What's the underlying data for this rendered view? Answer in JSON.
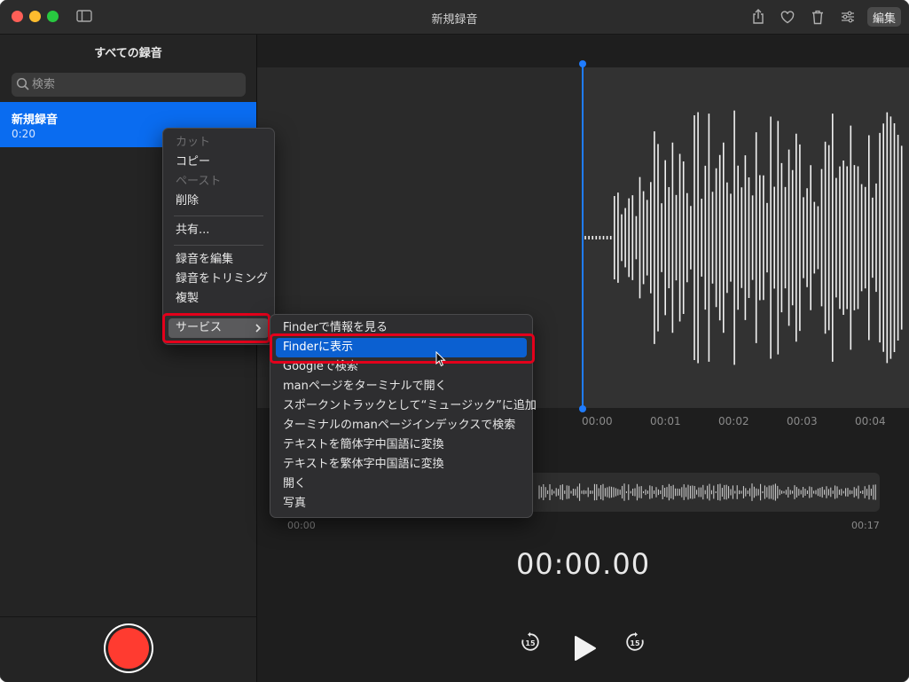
{
  "window": {
    "title": "新規録音",
    "edit_label": "編集"
  },
  "sidebar": {
    "title": "すべての録音",
    "search_placeholder": "検索",
    "recordings": [
      {
        "name": "新規録音",
        "duration": "0:20"
      }
    ]
  },
  "timeline": {
    "ticks": [
      "00:00",
      "00:01",
      "00:02",
      "00:03",
      "00:04"
    ],
    "overview_start": "00:00",
    "overview_end": "00:17"
  },
  "player": {
    "time": "00:00.00",
    "skip_back_label": "15",
    "skip_forward_label": "15"
  },
  "context_menu": {
    "items": [
      {
        "label": "カット",
        "enabled": false
      },
      {
        "label": "コピー",
        "enabled": true
      },
      {
        "label": "ペースト",
        "enabled": false
      },
      {
        "label": "削除",
        "enabled": true
      },
      {
        "label": "共有...",
        "enabled": true
      },
      {
        "label": "録音を編集",
        "enabled": true
      },
      {
        "label": "録音をトリミング",
        "enabled": true
      },
      {
        "label": "複製",
        "enabled": true
      },
      {
        "label": "サービス",
        "enabled": true,
        "submenu": true
      }
    ]
  },
  "services_menu": {
    "selected_index": 1,
    "items": [
      "Finderで情報を見る",
      "Finderに表示",
      "Googleで検索",
      "manページをターミナルで開く",
      "スポークントラックとして“ミュージック”に追加",
      "ターミナルのmanページインデックスで検索",
      "テキストを簡体字中国語に変換",
      "テキストを繁体字中国語に変換",
      "開く",
      "写真"
    ]
  },
  "colors": {
    "accent": "#0a6cf0",
    "record": "#ff3b30",
    "highlight_box": "#e3001b",
    "playhead": "#1f7cff"
  }
}
